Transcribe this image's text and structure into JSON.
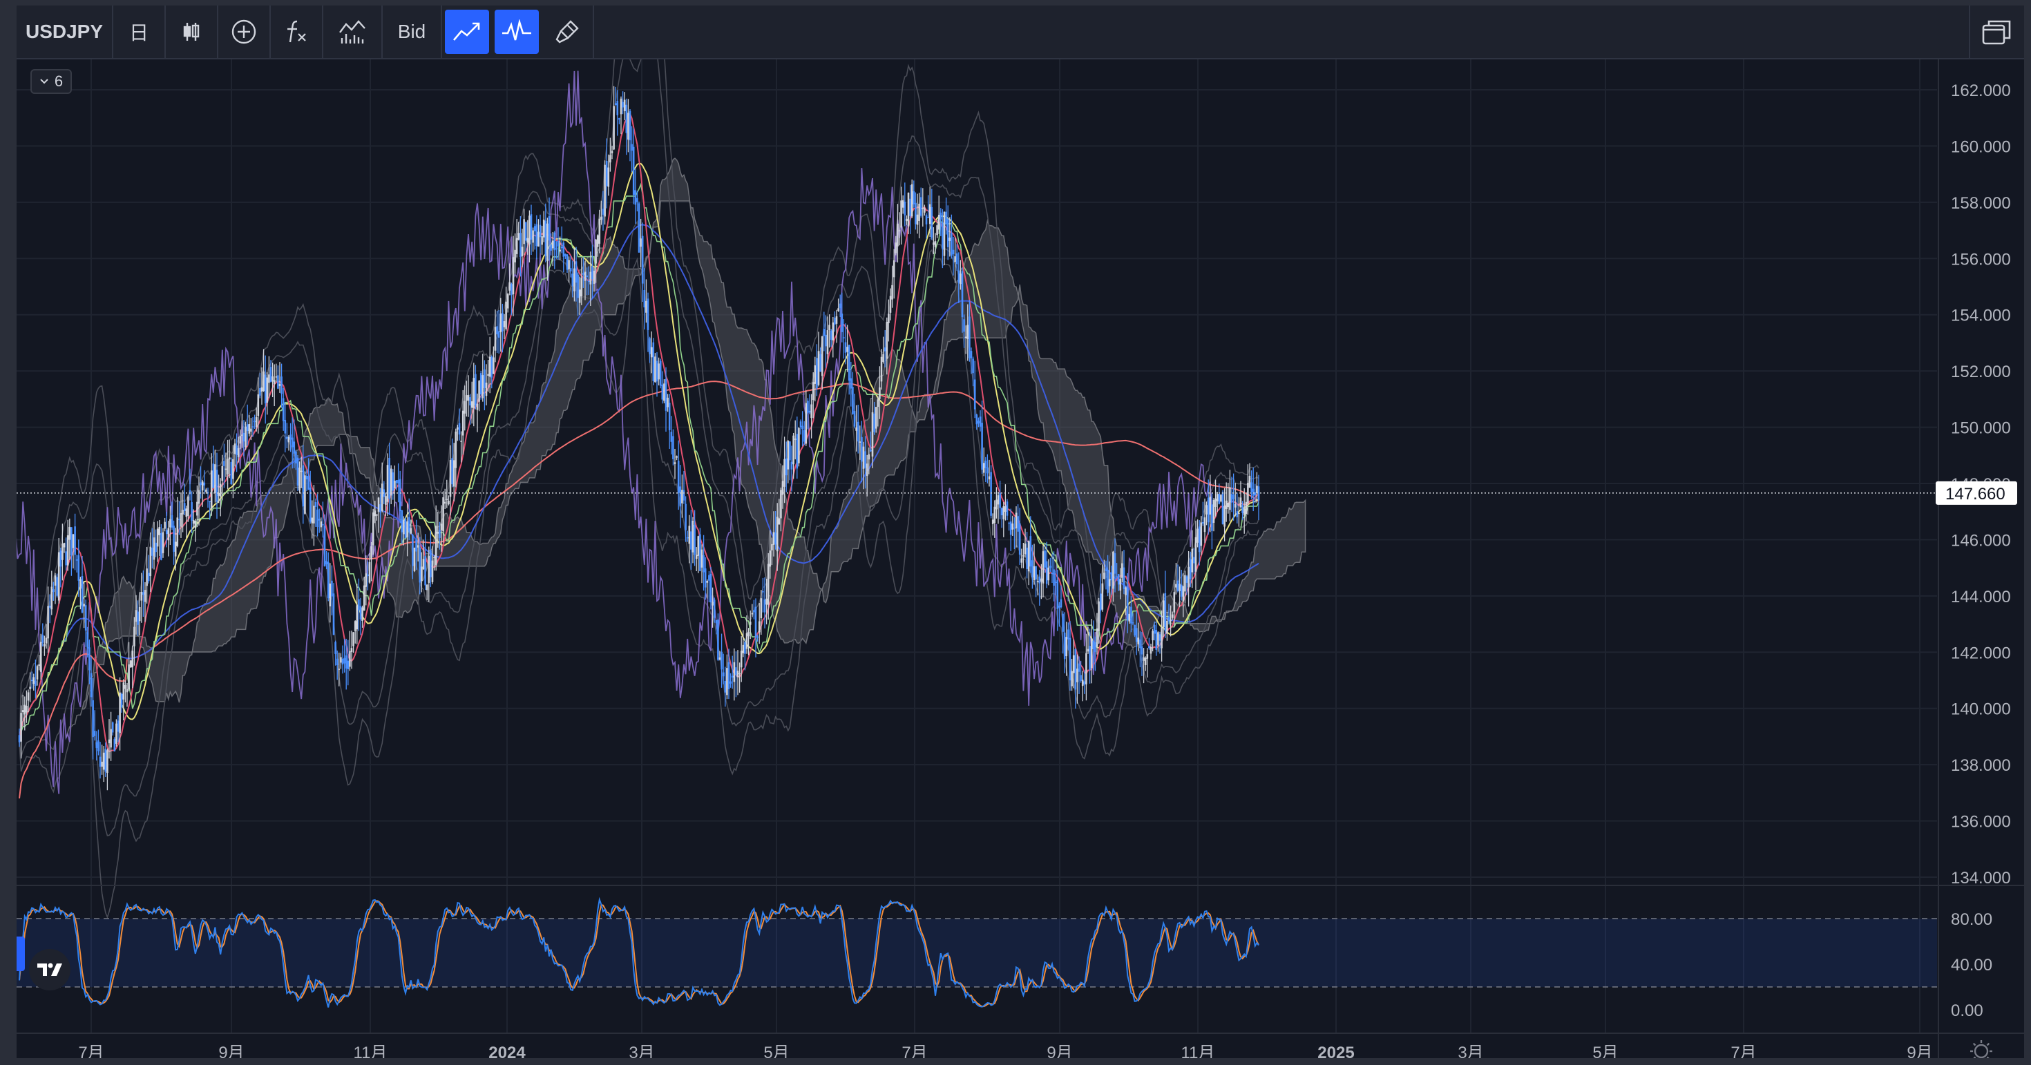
{
  "toolbar": {
    "symbol": "USDJPY",
    "timeframe": "日",
    "price_side": "Bid",
    "icons": [
      "candles-icon",
      "add-indicator-icon",
      "fx-formula-icon",
      "compare-icon",
      "line-chart-icon",
      "oscillator-icon",
      "brush-icon",
      "layout-windows-icon"
    ]
  },
  "legend_toggle": {
    "count": "6"
  },
  "chart_data": {
    "type": "line",
    "description_series": [
      "candles",
      "sma",
      "ichimoku-cloud",
      "bollinger",
      "stochastic"
    ],
    "price_axis": {
      "min": 134,
      "max": 162,
      "ticks": [
        "162.000",
        "160.000",
        "158.000",
        "156.000",
        "154.000",
        "152.000",
        "150.000",
        "148.000",
        "146.000",
        "144.000",
        "142.000",
        "140.000",
        "138.000",
        "136.000",
        "134.000"
      ]
    },
    "current_price": "147.660",
    "time_axis": [
      "7月",
      "9月",
      "11月",
      "2024",
      "3月",
      "5月",
      "7月",
      "9月",
      "11月",
      "2025",
      "3月",
      "5月",
      "7月",
      "9月"
    ],
    "close_anchors": [
      [
        0,
        139.5
      ],
      [
        30,
        146
      ],
      [
        45,
        138
      ],
      [
        80,
        146
      ],
      [
        110,
        148
      ],
      [
        140,
        151.5
      ],
      [
        165,
        147
      ],
      [
        180,
        141.5
      ],
      [
        205,
        148
      ],
      [
        225,
        145
      ],
      [
        255,
        151.5
      ],
      [
        285,
        157
      ],
      [
        315,
        155
      ],
      [
        335,
        161.5
      ],
      [
        355,
        152
      ],
      [
        375,
        146
      ],
      [
        395,
        141
      ],
      [
        410,
        143
      ],
      [
        430,
        149
      ],
      [
        455,
        154
      ],
      [
        470,
        149
      ],
      [
        495,
        158
      ],
      [
        515,
        157
      ],
      [
        545,
        147
      ],
      [
        570,
        145
      ],
      [
        590,
        141
      ],
      [
        610,
        145
      ],
      [
        625,
        142
      ],
      [
        645,
        144
      ],
      [
        665,
        147
      ],
      [
        690,
        147.7
      ]
    ],
    "oscillator": {
      "min": 0,
      "max": 100,
      "ticks": [
        "80.00",
        "40.00",
        "0.00"
      ],
      "upper": 80,
      "lower": 20
    },
    "colors": {
      "up": "#d1d4dc",
      "down": "#4a90ff",
      "sma_short": "#e0506e",
      "sma_mid": "#e8e27a",
      "sma_long": "#3d5ddc",
      "sma_200": "#f07070",
      "cloud": "#5d5f66",
      "bb": "#8a6fd0",
      "stoch_k": "#2f80ed",
      "stoch_d": "#f28c3a"
    }
  }
}
